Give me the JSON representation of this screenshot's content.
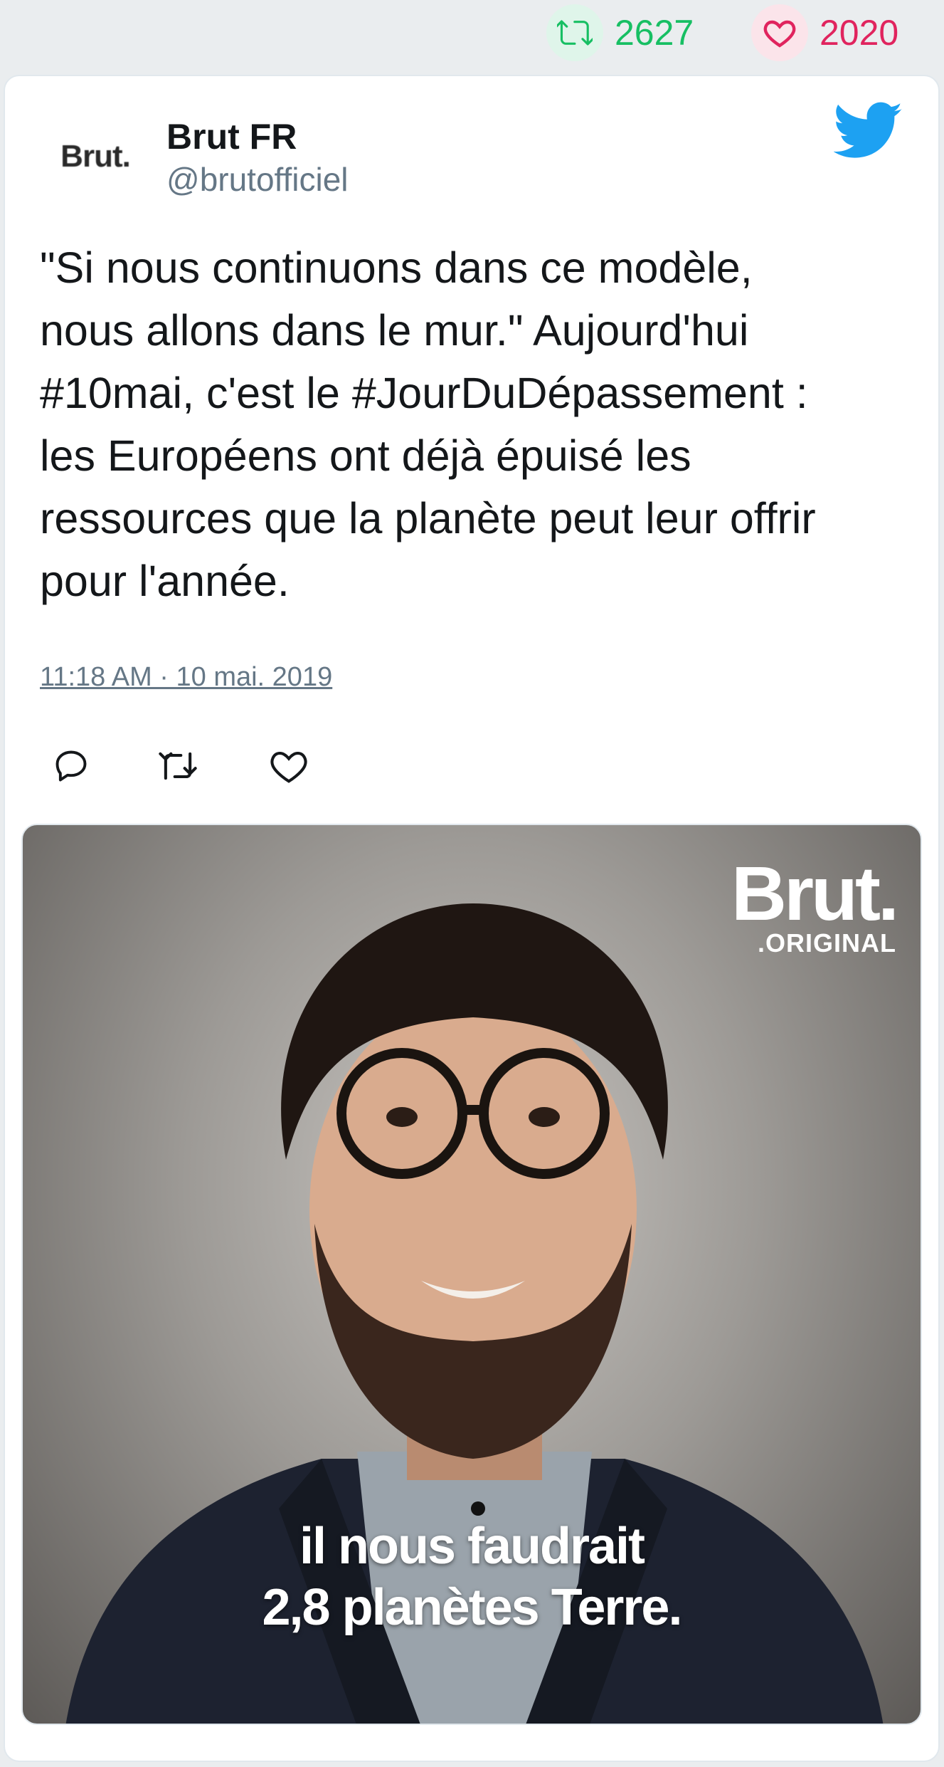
{
  "stats": {
    "retweets": "2627",
    "likes": "2020"
  },
  "author": {
    "avatar_text": "Brut.",
    "name": "Brut FR",
    "handle": "@brutofficiel"
  },
  "tweet": {
    "text": "\"Si nous continuons dans ce modèle,\nnous allons dans le mur.\" Aujourd'hui\n#10mai, c'est le #JourDuDépassement :\nles Européens ont déjà épuisé les\nressources que la planète peut leur offrir\npour l'année.",
    "timestamp": "11:18 AM · 10 mai. 2019"
  },
  "media": {
    "logo_main": "Brut.",
    "logo_sub": ".ORIGINAL",
    "caption_line1": "il nous faudrait",
    "caption_line2": "2,8 planètes Terre."
  },
  "icons": {
    "retweet": "retweet-icon",
    "like": "heart-icon",
    "reply": "reply-icon",
    "brand": "twitter-bird-icon"
  },
  "colors": {
    "retweet_green": "#17bf63",
    "like_red": "#e0245e",
    "twitter_blue": "#1da1f2",
    "text_dark": "#14171a",
    "text_muted": "#657786"
  }
}
